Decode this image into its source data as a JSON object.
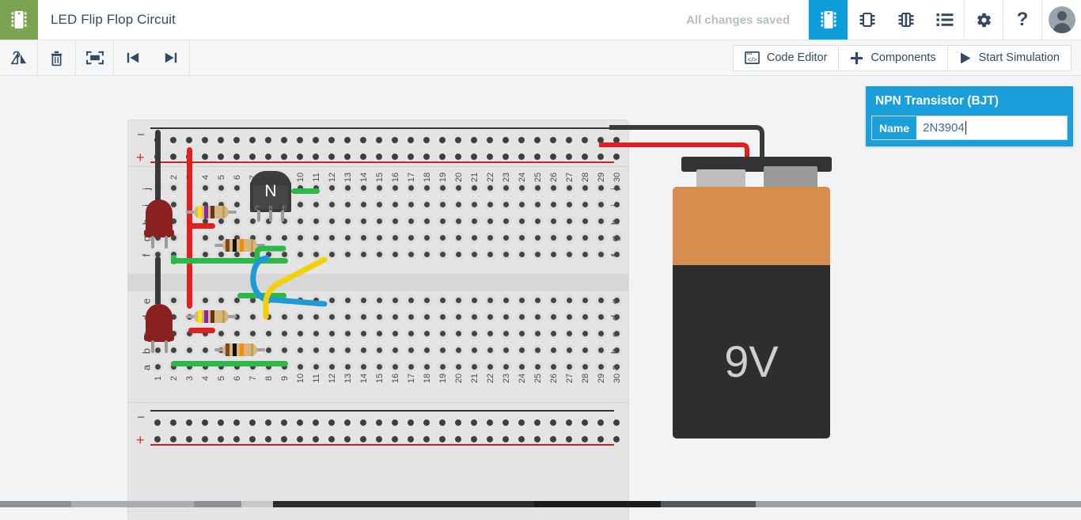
{
  "header": {
    "logo_icon": "chip-logo-icon",
    "title": "LED Flip Flop Circuit",
    "save_status": "All changes saved",
    "icons": [
      {
        "name": "breadboard-view-icon",
        "active": true
      },
      {
        "name": "schematic-view-icon",
        "active": false
      },
      {
        "name": "pcb-view-icon",
        "active": false
      },
      {
        "name": "parts-list-icon",
        "active": false
      },
      {
        "name": "settings-gear-icon",
        "active": false
      },
      {
        "name": "help-question-icon",
        "active": false
      }
    ],
    "avatar_label": "user-avatar"
  },
  "toolbar": {
    "left_icons": [
      {
        "name": "rotate-flip-icon",
        "label": "Rotate"
      },
      {
        "name": "delete-trash-icon",
        "label": "Delete"
      },
      {
        "name": "fit-to-screen-icon",
        "label": "Fit to screen"
      },
      {
        "name": "step-backward-icon",
        "label": "Step backward"
      },
      {
        "name": "step-forward-icon",
        "label": "Step forward"
      }
    ],
    "code_editor_label": "Code Editor",
    "components_label": "Components",
    "start_simulation_label": "Start Simulation"
  },
  "properties_panel": {
    "title": "NPN Transistor (BJT)",
    "fields": [
      {
        "label": "Name",
        "value": "2N3904",
        "focused": true
      }
    ]
  },
  "breadboard": {
    "columns": [
      "1",
      "2",
      "3",
      "4",
      "5",
      "6",
      "7",
      "8",
      "9",
      "10",
      "11",
      "12",
      "13",
      "14",
      "15",
      "16",
      "17",
      "18",
      "19",
      "20",
      "21",
      "22",
      "23",
      "24",
      "25",
      "26",
      "27",
      "28",
      "29",
      "30"
    ],
    "rows_top": [
      "j",
      "i",
      "h",
      "g",
      "f"
    ],
    "rows_bottom": [
      "e",
      "d",
      "c",
      "b",
      "a"
    ],
    "rail_symbols": {
      "negative": "–",
      "positive": "+"
    }
  },
  "components": {
    "transistor": {
      "name": "npn-transistor",
      "face_letter": "N",
      "pins": [
        "C",
        "B",
        "E"
      ]
    },
    "leds": [
      {
        "name": "led-top",
        "color": "#8b2020"
      },
      {
        "name": "led-bottom",
        "color": "#8b2020"
      }
    ],
    "resistors": [
      {
        "name": "resistor-top-1",
        "bands": [
          "#f5e400",
          "#8e24aa",
          "#5d3a1a",
          "#b9a64a"
        ]
      },
      {
        "name": "resistor-top-2",
        "bands": [
          "#7b4a1e",
          "#111111",
          "#f08c00",
          "#b9a64a"
        ]
      },
      {
        "name": "resistor-bottom-1",
        "bands": [
          "#f5e400",
          "#8e24aa",
          "#5d3a1a",
          "#b9a64a"
        ]
      },
      {
        "name": "resistor-bottom-2",
        "bands": [
          "#7b4a1e",
          "#111111",
          "#f08c00",
          "#b9a64a"
        ]
      }
    ],
    "wires": [
      {
        "name": "wire-black-top-rail",
        "color": "#333333"
      },
      {
        "name": "wire-red-top-rail",
        "color": "#e02020"
      },
      {
        "name": "wire-green-top",
        "color": "#2db84a"
      },
      {
        "name": "wire-green-bottom",
        "color": "#2db84a"
      },
      {
        "name": "wire-blue-cross",
        "color": "#1e9ad6"
      },
      {
        "name": "wire-yellow-cross",
        "color": "#f5d000"
      }
    ],
    "battery": {
      "name": "battery-9v",
      "label": "9V",
      "positive_clip_color": "#cc2222",
      "negative_clip_color": "#222222",
      "body_top_color": "#d68d4e",
      "body_bottom_color": "#2e2e2e"
    }
  },
  "colors": {
    "accent": "#0d9ddb",
    "logo_green": "#7aa352",
    "text_dark": "#344a63",
    "canvas_bg": "#f1f3f5",
    "board_bg": "#e4e4e4"
  }
}
